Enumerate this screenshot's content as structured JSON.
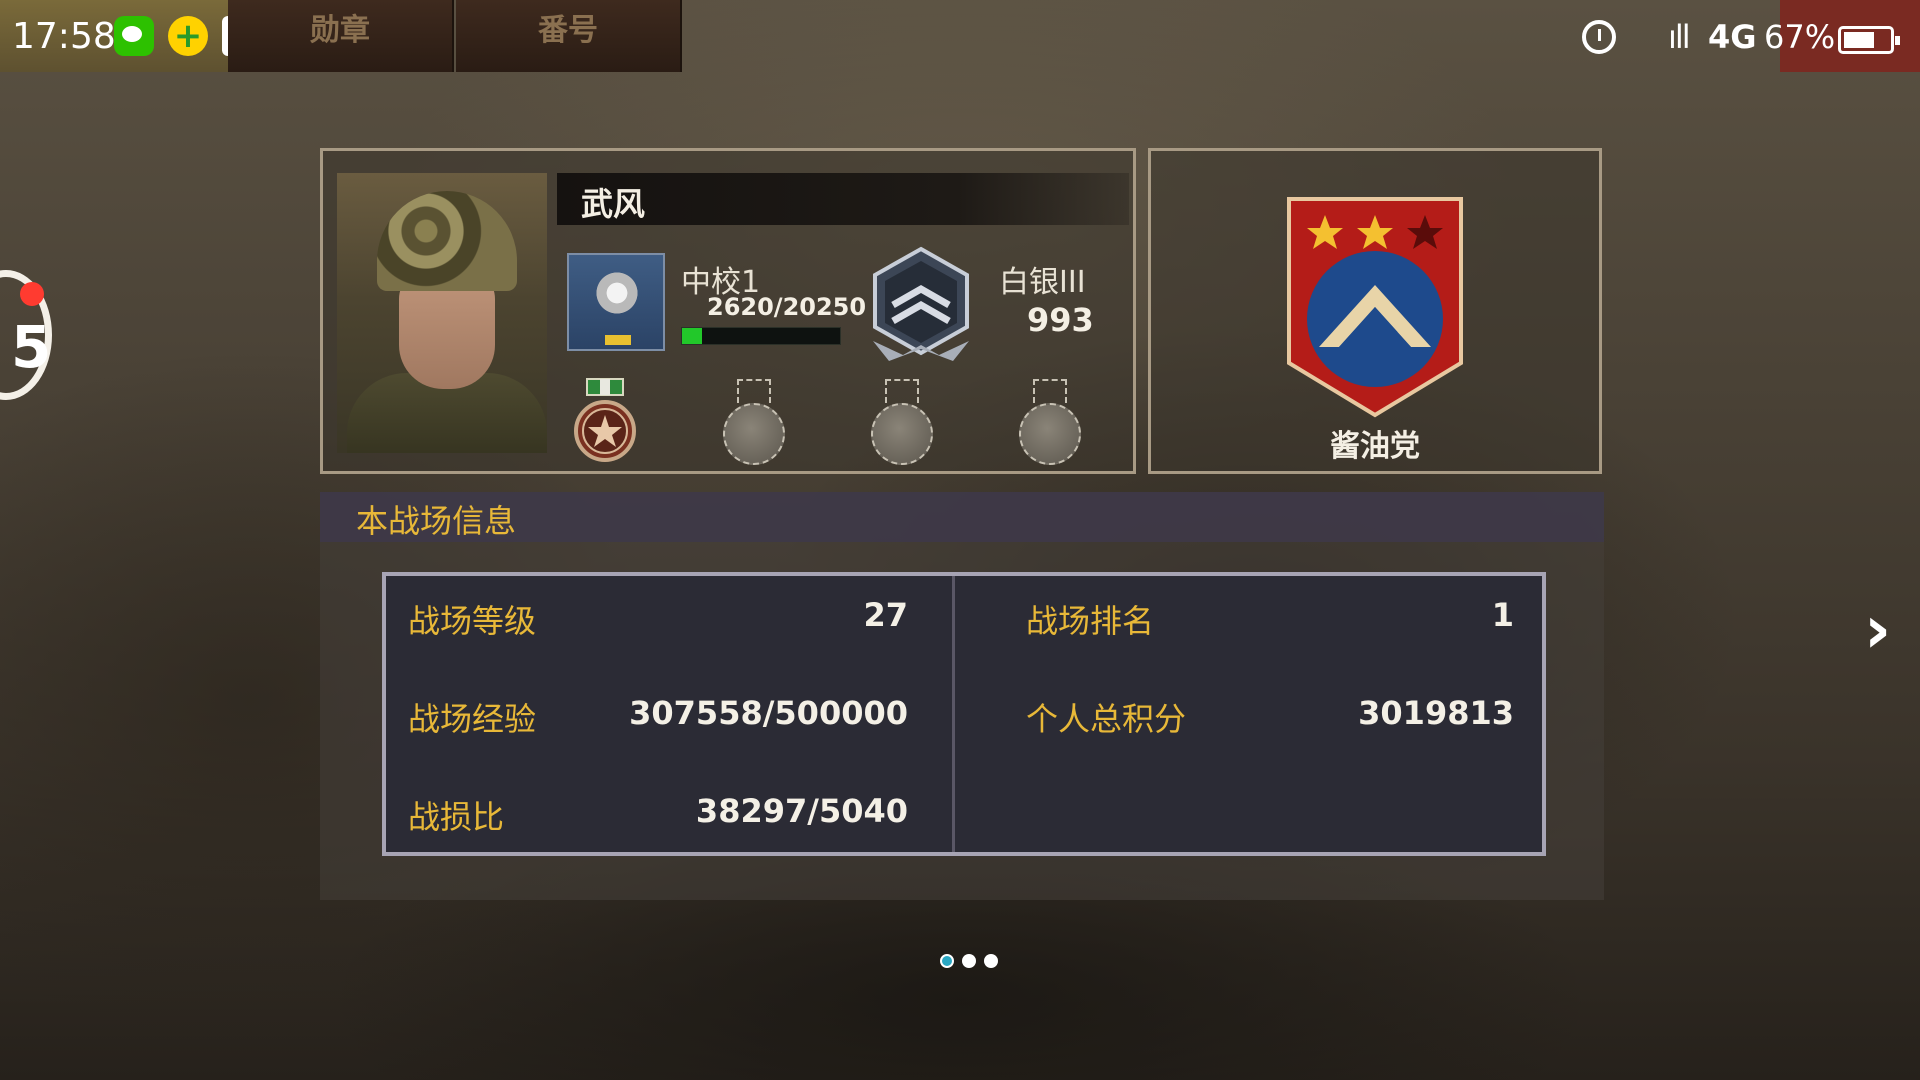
{
  "status_bar": {
    "time": "17:58",
    "network": "4G",
    "signal": "ıll",
    "battery_percent": "67%",
    "battery_level": 0.67
  },
  "top_tabs": [
    {
      "label": "勋章"
    },
    {
      "label": "番号"
    }
  ],
  "floating_widget": {
    "number": "5"
  },
  "player": {
    "name": "武风",
    "rank_title": "中校1",
    "rank_xp": "2620/20250",
    "rank_xp_fraction": 0.129,
    "tier_title": "白银III",
    "tier_score": "993"
  },
  "guild": {
    "name": "酱油党",
    "stars_filled": 2,
    "stars_total": 3
  },
  "info": {
    "title": "本战场信息",
    "stats": {
      "level": {
        "label": "战场等级",
        "value": "27"
      },
      "rank": {
        "label": "战场排名",
        "value": "1"
      },
      "exp": {
        "label": "战场经验",
        "value": "307558/500000"
      },
      "total_score": {
        "label": "个人总积分",
        "value": "3019813"
      },
      "kd": {
        "label": "战损比",
        "value": "38297/5040"
      }
    }
  },
  "pager": {
    "current_page": 1,
    "total_pages": 3
  },
  "colors": {
    "accent_gold": "#e8b838",
    "xp_green": "#22c82a",
    "guild_red": "#c8241c",
    "guild_blue": "#1e4a8c"
  },
  "icons": {
    "next": "chevron-right-icon",
    "alarm": "alarm-icon",
    "battery": "battery-icon"
  }
}
